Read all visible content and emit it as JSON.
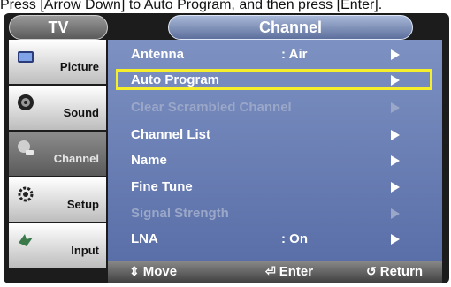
{
  "caption": "Press [Arrow Down] to Auto Program, and then press [Enter].",
  "tv_label": "TV",
  "menu_title": "Channel",
  "sidebar": {
    "items": [
      {
        "label": "Picture",
        "icon": "picture-icon",
        "active": false
      },
      {
        "label": "Sound",
        "icon": "sound-icon",
        "active": false
      },
      {
        "label": "Channel",
        "icon": "channel-icon",
        "active": true
      },
      {
        "label": "Setup",
        "icon": "setup-icon",
        "active": false
      },
      {
        "label": "Input",
        "icon": "input-icon",
        "active": false
      }
    ]
  },
  "rows": [
    {
      "name": "Antenna",
      "value": ": Air",
      "enabled": true,
      "selected": false
    },
    {
      "name": "Auto Program",
      "value": "",
      "enabled": true,
      "selected": true
    },
    {
      "name": "Clear Scrambled Channel",
      "value": "",
      "enabled": false,
      "selected": false
    },
    {
      "name": "Channel List",
      "value": "",
      "enabled": true,
      "selected": false
    },
    {
      "name": "Name",
      "value": "",
      "enabled": true,
      "selected": false
    },
    {
      "name": "Fine Tune",
      "value": "",
      "enabled": true,
      "selected": false
    },
    {
      "name": "Signal Strength",
      "value": "",
      "enabled": false,
      "selected": false
    },
    {
      "name": "LNA",
      "value": ": On",
      "enabled": true,
      "selected": false
    }
  ],
  "footer": {
    "move": "Move",
    "enter": "Enter",
    "return": "Return"
  },
  "colors": {
    "highlight": "#f4ef2a",
    "panel": "#6a7fb4",
    "sidebar_active": "#6f6f6f"
  }
}
